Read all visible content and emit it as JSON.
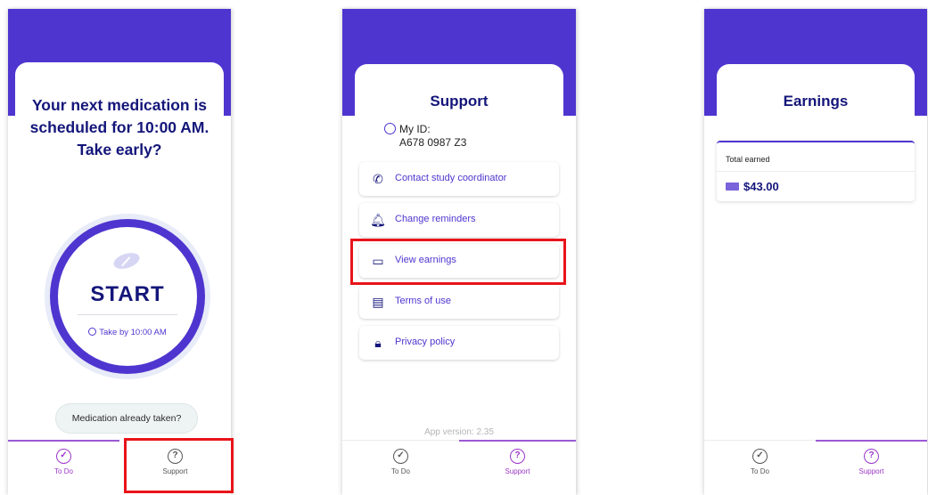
{
  "screen1": {
    "title_line1": "Your next medication is",
    "title_line2": "scheduled for 10:00 AM.",
    "title_line3": "Take early?",
    "start_label": "START",
    "take_by": "Take by 10:00 AM",
    "already_taken": "Medication already taken?",
    "nav": {
      "todo": "To Do",
      "support": "Support"
    }
  },
  "screen2": {
    "title": "Support",
    "my_id_label": "My ID:",
    "my_id_value": "A678 0987 Z3",
    "rows": [
      {
        "label": "Contact study coordinator",
        "icon": "phone-icon"
      },
      {
        "label": "Change reminders",
        "icon": "bell-icon"
      },
      {
        "label": "View earnings",
        "icon": "credit-card-icon"
      },
      {
        "label": "Terms of use",
        "icon": "document-icon"
      },
      {
        "label": "Privacy policy",
        "icon": "lock-icon"
      }
    ],
    "app_version": "App version: 2.35",
    "nav": {
      "todo": "To Do",
      "support": "Support"
    }
  },
  "screen3": {
    "title": "Earnings",
    "total_label": "Total earned",
    "total_value": "$43.00",
    "nav": {
      "todo": "To Do",
      "support": "Support"
    }
  },
  "colors": {
    "primary": "#4f35cf",
    "heading": "#14167a",
    "accent": "#9b35c9",
    "highlight": "#e8141a"
  }
}
